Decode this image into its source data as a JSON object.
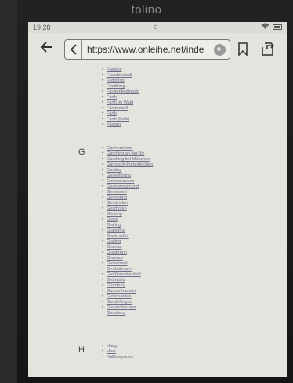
{
  "device": {
    "brand": "tolino"
  },
  "status": {
    "time": "19:28"
  },
  "toolbar": {
    "url": "https://www.onleihe.net/index"
  },
  "sections": {
    "f": {
      "letter": "",
      "items": [
        "Freising",
        "Freudenstadt",
        "Fridolfing",
        "Friedberg",
        "Fürstenfeldbruck",
        "Furth",
        "Furth im Wald",
        "Fürstenzell",
        "Fürth",
        "Furth (Kolb)",
        "Füssen"
      ]
    },
    "g": {
      "letter": "G",
      "items": [
        "Garmersheim",
        "Garching an der Alz",
        "Garching bei München",
        "Garmisch-Partenkirchen",
        "Gauting",
        "Geiselhöring",
        "Geisenhausen",
        "Georgensgmünd",
        "Geretsried",
        "Germering",
        "Gersthofen",
        "Gerzhofen",
        "Gilching",
        "Glonn",
        "Grafing",
        "Grafelfing",
        "Grafenwöhr",
        "Grafing",
        "Grainau",
        "Grasbrunn",
        "Grassau",
        "Grobenzell",
        "Großaitingen",
        "Großkarolinenfeld",
        "Grünwald",
        "Günzburg",
        "Gunzenhausen",
        "Gutenstetten",
        "Gundelfingen",
        "Gunzenhausen",
        "Gunzburg"
      ]
    },
    "h": {
      "letter": "H",
      "items": [
        "Haag",
        "Haar",
        "Hallbergmoos"
      ]
    }
  }
}
